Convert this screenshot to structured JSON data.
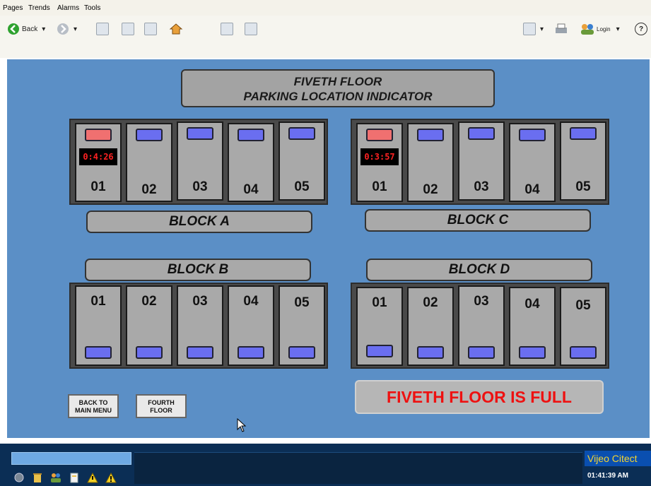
{
  "menu": {
    "items": [
      "Pages",
      "Trends",
      "Alarms",
      "Tools"
    ]
  },
  "toolbar": {
    "back_label": "Back",
    "login_label": "Login",
    "help_label": "?"
  },
  "header": {
    "line1": "FIVETH FLOOR",
    "line2": "PARKING LOCATION INDICATOR"
  },
  "block_a": {
    "label": "BLOCK A",
    "slots": [
      {
        "num": "01",
        "status": "occupied",
        "timer": "0:4:26"
      },
      {
        "num": "02",
        "status": "free"
      },
      {
        "num": "03",
        "status": "free"
      },
      {
        "num": "04",
        "status": "free"
      },
      {
        "num": "05",
        "status": "free"
      }
    ]
  },
  "block_c": {
    "label": "BLOCK C",
    "slots": [
      {
        "num": "01",
        "status": "occupied",
        "timer": "0:3:57"
      },
      {
        "num": "02",
        "status": "free"
      },
      {
        "num": "03",
        "status": "free"
      },
      {
        "num": "04",
        "status": "free"
      },
      {
        "num": "05",
        "status": "free"
      }
    ]
  },
  "block_b": {
    "label": "BLOCK B",
    "slots": [
      {
        "num": "01",
        "status": "free"
      },
      {
        "num": "02",
        "status": "free"
      },
      {
        "num": "03",
        "status": "free"
      },
      {
        "num": "04",
        "status": "free"
      },
      {
        "num": "05",
        "status": "free"
      }
    ]
  },
  "block_d": {
    "label": "BLOCK D",
    "slots": [
      {
        "num": "01",
        "status": "free"
      },
      {
        "num": "02",
        "status": "free"
      },
      {
        "num": "03",
        "status": "free"
      },
      {
        "num": "04",
        "status": "free"
      },
      {
        "num": "05",
        "status": "free"
      }
    ]
  },
  "buttons": {
    "main_menu_line1": "BACK TO",
    "main_menu_line2": "MAIN MENU",
    "fourth_line1": "FOURTH",
    "fourth_line2": "FLOOR"
  },
  "status_message": "FIVETH FLOOR IS FULL",
  "statusbar": {
    "brand": "Vijeo Citect",
    "time": "01:41:39 AM"
  },
  "colors": {
    "screen_bg": "#5b8fc6",
    "free": "#6a6ef0",
    "occupied": "#f07070",
    "alert_text": "#ee1111",
    "statusbar": "#0b2e55"
  }
}
